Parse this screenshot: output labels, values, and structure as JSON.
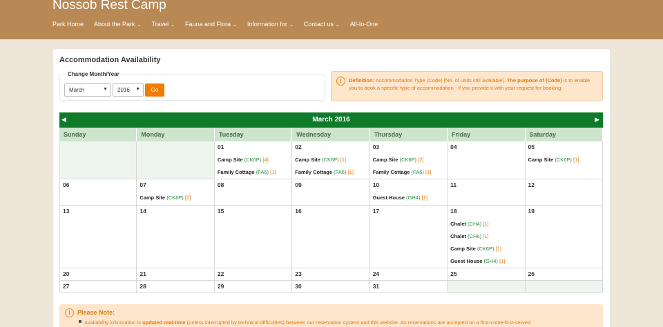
{
  "header": {
    "title": "Nossob Rest Camp",
    "nav": [
      {
        "label": "Park Home",
        "dropdown": false
      },
      {
        "label": "About the Park",
        "dropdown": true
      },
      {
        "label": "Travel",
        "dropdown": true
      },
      {
        "label": "Fauna and Flora",
        "dropdown": true
      },
      {
        "label": "Information for",
        "dropdown": true
      },
      {
        "label": "Contact us",
        "dropdown": true
      },
      {
        "label": "All-In-One",
        "dropdown": false
      }
    ]
  },
  "panel": {
    "title": "Accommodation Availability",
    "change_label": "Change Month/Year",
    "month_value": "March",
    "year_value": "2016",
    "go_label": "Go"
  },
  "definition": {
    "label": "Definition:",
    "text1": " Accommodation Type (Code) [No. of units still available]. ",
    "purpose_label": "The purpose of (Code)",
    "text2": " is to enable you to book a specific type of accommodation - if you provide it with your request for booking."
  },
  "calendar": {
    "month_title": "March 2016",
    "prev_icon": "◀",
    "next_icon": "▶",
    "weekdays": [
      "Sunday",
      "Monday",
      "Tuesday",
      "Wednesday",
      "Thursday",
      "Friday",
      "Saturday"
    ],
    "weeks": [
      [
        {
          "day": "",
          "entries": []
        },
        {
          "day": "",
          "entries": []
        },
        {
          "day": "01",
          "entries": [
            {
              "name": "Camp Site",
              "code": "(CK6P)",
              "count": "[4]"
            },
            {
              "name": "Family Cottage",
              "code": "(FA6)",
              "count": "[1]"
            }
          ]
        },
        {
          "day": "02",
          "entries": [
            {
              "name": "Camp Site",
              "code": "(CK6P)",
              "count": "[1]"
            },
            {
              "name": "Family Cottage",
              "code": "(FA6)",
              "count": "[1]"
            }
          ]
        },
        {
          "day": "03",
          "entries": [
            {
              "name": "Camp Site",
              "code": "(CK6P)",
              "count": "[2]"
            },
            {
              "name": "Family Cottage",
              "code": "(FA6)",
              "count": "[1]"
            }
          ]
        },
        {
          "day": "04",
          "entries": []
        },
        {
          "day": "05",
          "entries": [
            {
              "name": "Camp Site",
              "code": "(CK6P)",
              "count": "[1]"
            }
          ]
        }
      ],
      [
        {
          "day": "06",
          "entries": []
        },
        {
          "day": "07",
          "entries": [
            {
              "name": "Camp Site",
              "code": "(CK6P)",
              "count": "[2]"
            }
          ]
        },
        {
          "day": "08",
          "entries": []
        },
        {
          "day": "09",
          "entries": []
        },
        {
          "day": "10",
          "entries": [
            {
              "name": "Guest House",
              "code": "(GH4)",
              "count": "[1]"
            }
          ]
        },
        {
          "day": "11",
          "entries": []
        },
        {
          "day": "12",
          "entries": []
        }
      ],
      [
        {
          "day": "13",
          "entries": []
        },
        {
          "day": "14",
          "entries": []
        },
        {
          "day": "15",
          "entries": []
        },
        {
          "day": "16",
          "entries": []
        },
        {
          "day": "17",
          "entries": []
        },
        {
          "day": "18",
          "entries": [
            {
              "name": "Chalet",
              "code": "(CH4)",
              "count": "[1]"
            },
            {
              "name": "Chalet",
              "code": "(CH6)",
              "count": "[1]"
            },
            {
              "name": "Camp Site",
              "code": "(CK6P)",
              "count": "[1]"
            },
            {
              "name": "Guest House",
              "code": "(GH4)",
              "count": "[1]"
            }
          ]
        },
        {
          "day": "19",
          "entries": []
        }
      ],
      [
        {
          "day": "20",
          "entries": []
        },
        {
          "day": "21",
          "entries": []
        },
        {
          "day": "22",
          "entries": []
        },
        {
          "day": "23",
          "entries": []
        },
        {
          "day": "24",
          "entries": []
        },
        {
          "day": "25",
          "entries": []
        },
        {
          "day": "26",
          "entries": []
        }
      ],
      [
        {
          "day": "27",
          "entries": []
        },
        {
          "day": "28",
          "entries": []
        },
        {
          "day": "29",
          "entries": []
        },
        {
          "day": "30",
          "entries": []
        },
        {
          "day": "31",
          "entries": []
        },
        {
          "day": "",
          "entries": []
        },
        {
          "day": "",
          "entries": []
        }
      ]
    ]
  },
  "note": {
    "title": "Please Note:",
    "text_start": "Availability information is ",
    "highlight": "updated real-time",
    "text_end": " (unless interrupted by technical difficulties) between our reservation system and this website. As reservations are accepted on a first-come-first-served"
  }
}
